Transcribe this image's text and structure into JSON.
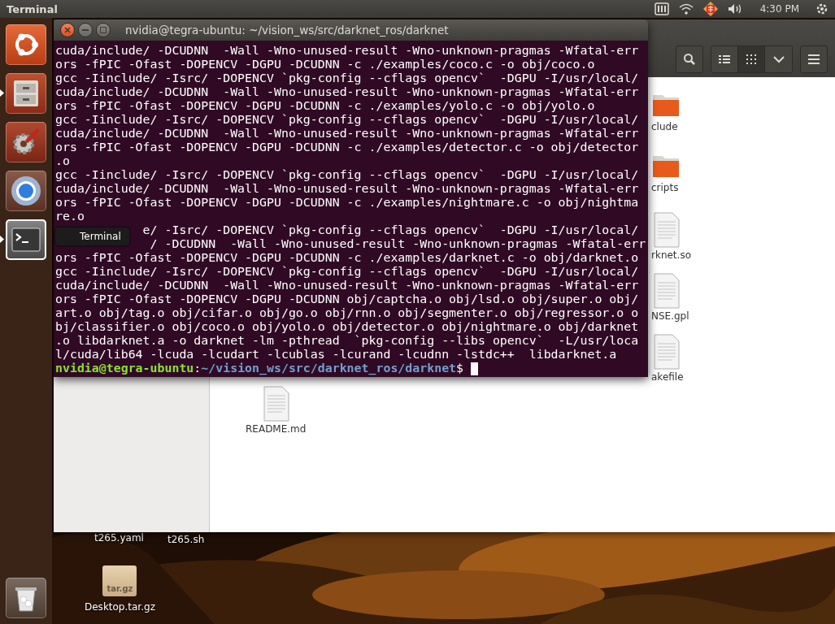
{
  "top_panel": {
    "app_title": "Terminal",
    "clock": "4:30 PM"
  },
  "launcher": {
    "items": [
      {
        "kind": "ubuntu",
        "running": false,
        "focused": false
      },
      {
        "kind": "files",
        "running": true,
        "focused": false
      },
      {
        "kind": "settings",
        "running": false,
        "focused": false
      },
      {
        "kind": "browser",
        "running": false,
        "focused": false
      },
      {
        "kind": "terminal",
        "running": true,
        "focused": true
      }
    ],
    "trash": {
      "kind": "trash"
    },
    "tooltip": "Terminal"
  },
  "terminal": {
    "title": "nvidia@tegra-ubuntu: ~/vision_ws/src/darknet_ros/darknet",
    "lines": [
      "cuda/include/ -DCUDNN  -Wall -Wno-unused-result -Wno-unknown-pragmas -Wfatal-err",
      "ors -fPIC -Ofast -DOPENCV -DGPU -DCUDNN -c ./examples/coco.c -o obj/coco.o",
      "gcc -Iinclude/ -Isrc/ -DOPENCV `pkg-config --cflags opencv`  -DGPU -I/usr/local/",
      "cuda/include/ -DCUDNN  -Wall -Wno-unused-result -Wno-unknown-pragmas -Wfatal-err",
      "ors -fPIC -Ofast -DOPENCV -DGPU -DCUDNN -c ./examples/yolo.c -o obj/yolo.o",
      "gcc -Iinclude/ -Isrc/ -DOPENCV `pkg-config --cflags opencv`  -DGPU -I/usr/local/",
      "cuda/include/ -DCUDNN  -Wall -Wno-unused-result -Wno-unknown-pragmas -Wfatal-err",
      "ors -fPIC -Ofast -DOPENCV -DGPU -DCUDNN -c ./examples/detector.c -o obj/detector",
      ".o",
      "gcc -Iinclude/ -Isrc/ -DOPENCV `pkg-config --cflags opencv`  -DGPU -I/usr/local/",
      "cuda/include/ -DCUDNN  -Wall -Wno-unused-result -Wno-unknown-pragmas -Wfatal-err",
      "ors -fPIC -Ofast -DOPENCV -DGPU -DCUDNN -c ./examples/nightmare.c -o obj/nightma",
      "re.o",
      "            e/ -Isrc/ -DOPENCV `pkg-config --cflags opencv`  -DGPU -I/usr/local/",
      "             / -DCUDNN  -Wall -Wno-unused-result -Wno-unknown-pragmas -Wfatal-err",
      "ors -fPIC -Ofast -DOPENCV -DGPU -DCUDNN -c ./examples/darknet.c -o obj/darknet.o",
      "gcc -Iinclude/ -Isrc/ -DOPENCV `pkg-config --cflags opencv`  -DGPU -I/usr/local/",
      "cuda/include/ -DCUDNN  -Wall -Wno-unused-result -Wno-unknown-pragmas -Wfatal-err",
      "ors -fPIC -Ofast -DOPENCV -DGPU -DCUDNN obj/captcha.o obj/lsd.o obj/super.o obj/",
      "art.o obj/tag.o obj/cifar.o obj/go.o obj/rnn.o obj/segmenter.o obj/regressor.o o",
      "bj/classifier.o obj/coco.o obj/yolo.o obj/detector.o obj/nightmare.o obj/darknet",
      ".o libdarknet.a -o darknet -lm -pthread  `pkg-config --libs opencv`  -L/usr/loca",
      "l/cuda/lib64 -lcuda -lcudart -lcublas -lcurand -lcudnn -lstdc++  libdarknet.a"
    ],
    "prompt": {
      "user": "nvidia@tegra-ubuntu",
      "separator": ":",
      "path": "~/vision_ws/src/darknet_ros/darknet",
      "symbol": "$"
    }
  },
  "files": {
    "view_buttons": [
      {
        "kind": "list",
        "selected": false
      },
      {
        "kind": "grid",
        "selected": true
      },
      {
        "kind": "dropdown",
        "selected": false
      }
    ],
    "column_items": [
      {
        "kind": "folder",
        "label": "clude"
      },
      {
        "kind": "folder",
        "label": "cripts"
      },
      {
        "kind": "file",
        "label": "rknet.so"
      },
      {
        "kind": "file",
        "label": "NSE.gpl"
      },
      {
        "kind": "file",
        "label": "akefile"
      }
    ],
    "lower_items": [
      {
        "kind": "file",
        "label": "README.md"
      }
    ]
  },
  "desktop": {
    "icons": [
      {
        "kind": "hidden",
        "label": "t265.yaml"
      },
      {
        "kind": "hidden",
        "label": "t265.sh"
      },
      {
        "kind": "archive",
        "badge": "tar.gz",
        "label": "Desktop.tar.gz"
      }
    ]
  }
}
